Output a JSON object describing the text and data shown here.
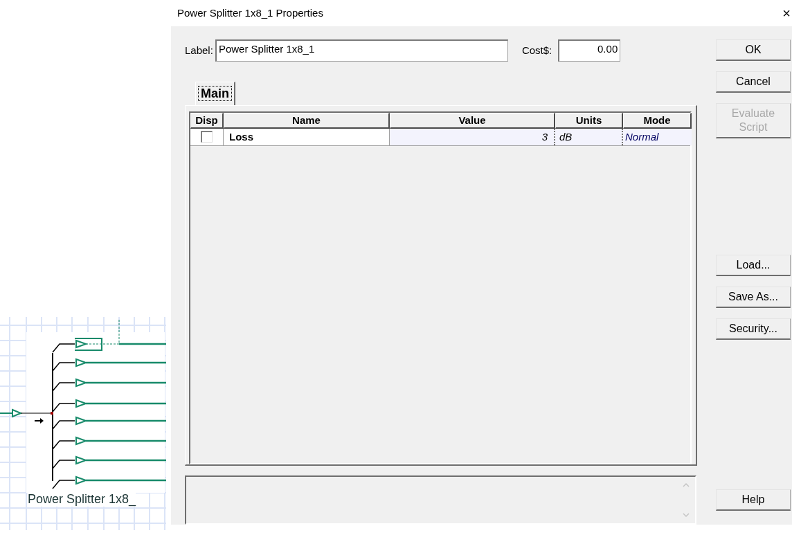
{
  "canvas": {
    "component_label": "Power Splitter 1x8_"
  },
  "dialog": {
    "title": "Power Splitter 1x8_1 Properties",
    "close": "×",
    "label_field": {
      "label": "Label:",
      "value": "Power Splitter 1x8_1"
    },
    "cost_field": {
      "label": "Cost$:",
      "value": "0.00"
    },
    "tabs": [
      {
        "label": "Main",
        "selected": true
      }
    ],
    "table": {
      "columns": [
        "Disp",
        "Name",
        "Value",
        "Units",
        "Mode"
      ],
      "rows": [
        {
          "checked": false,
          "name": "Loss",
          "value": "3",
          "units": "dB",
          "mode": "Normal"
        }
      ]
    },
    "buttons_top": [
      {
        "label": "OK",
        "disabled": false
      },
      {
        "label": "Cancel",
        "disabled": false
      },
      {
        "label": "Evaluate Script",
        "disabled": true
      }
    ],
    "buttons_middle": [
      {
        "label": "Load...",
        "disabled": false
      },
      {
        "label": "Save As...",
        "disabled": false
      },
      {
        "label": "Security...",
        "disabled": false
      }
    ],
    "buttons_bottom": [
      {
        "label": "Help",
        "disabled": false
      }
    ]
  }
}
